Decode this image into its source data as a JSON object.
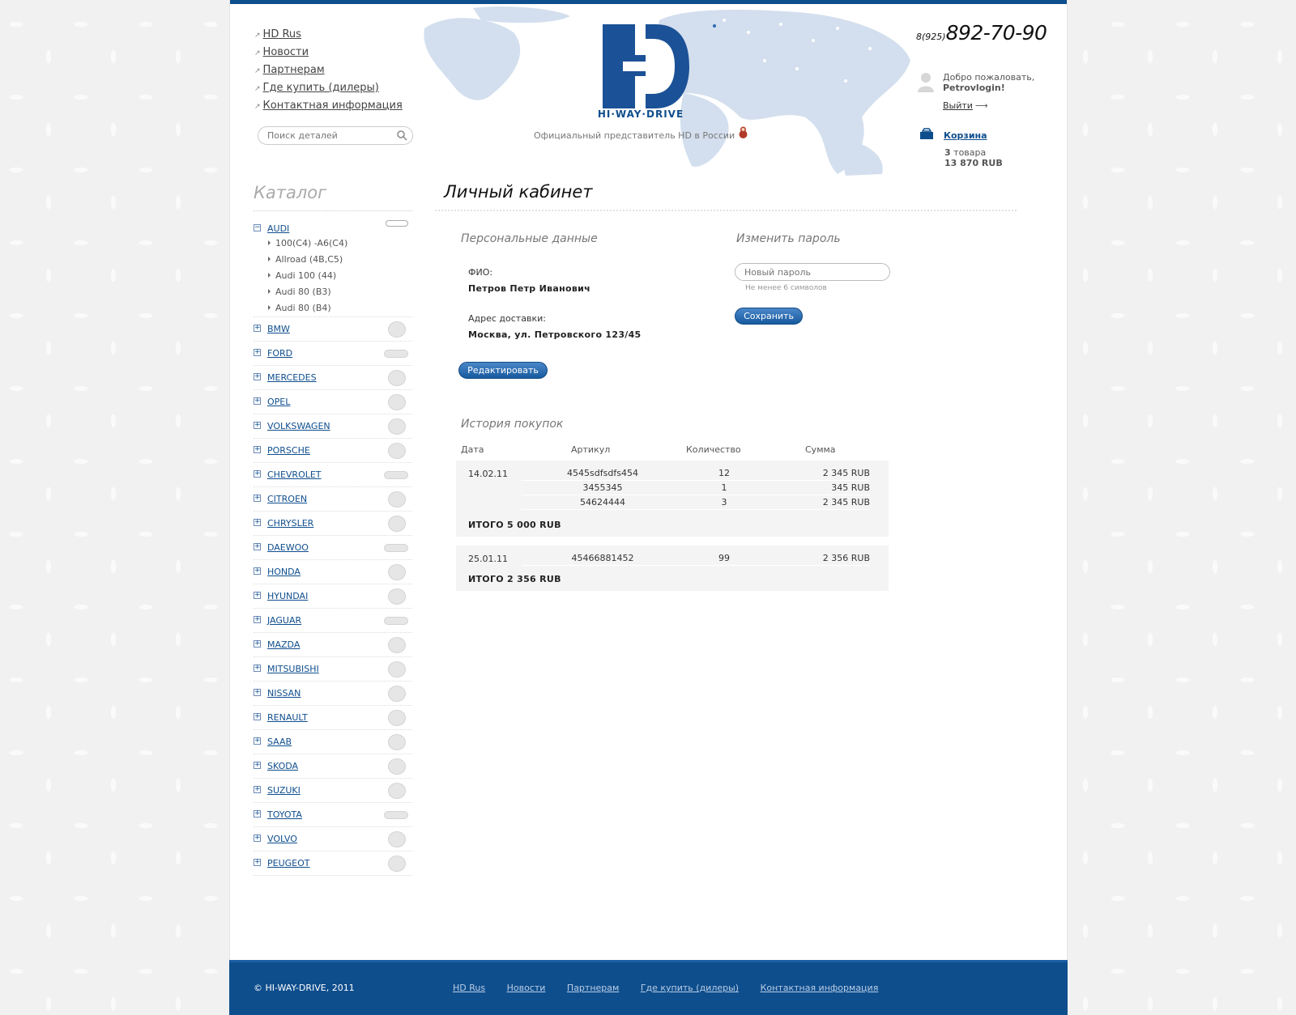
{
  "header": {
    "nav": [
      "HD Rus",
      "Новости",
      "Партнерам",
      "Где купить (дилеры)",
      "Контактная информация"
    ],
    "search_placeholder": "Поиск деталей",
    "logo_text": "HI·WAY·DRIVE",
    "tagline": "Официальный представитель HD в России",
    "phone_prefix": "8(925)",
    "phone_number": "892-70-90",
    "welcome": "Добро пожаловать,",
    "login": "Petrovlogin!",
    "logout": "Выйти",
    "cart_title": "Корзина",
    "cart_count": "3",
    "cart_count_label": "товара",
    "cart_sum": "13 870 RUB"
  },
  "catalog": {
    "title": "Каталог",
    "open_brand": "AUDI",
    "models": [
      "100(C4) -A6(C4)",
      "Allroad (4B,C5)",
      "Audi 100 (44)",
      "Audi 80 (B3)",
      "Audi 80 (B4)"
    ],
    "brands": [
      "BMW",
      "FORD",
      "MERCEDES",
      "OPEL",
      "VOLKSWAGEN",
      "PORSCHE",
      "CHEVROLET",
      "CITROEN",
      "CHRYSLER",
      "DAEWOO",
      "HONDA",
      "HYUNDAI",
      "JAGUAR",
      "MAZDA",
      "MITSUBISHI",
      "NISSAN",
      "RENAULT",
      "SAAB",
      "SKODA",
      "SUZUKI",
      "TOYOTA",
      "VOLVO",
      "PEUGEOT"
    ],
    "toggle_open": "−",
    "toggle_closed": "+"
  },
  "main": {
    "title": "Личный кабинет",
    "personal_title": "Персональные данные",
    "fio_label": "ФИО:",
    "fio_value": "Петров Петр Иванович",
    "address_label": "Адрес доставки:",
    "address_value": "Москва, ул. Петровского 123/45",
    "edit_button": "Редактировать",
    "password_title": "Изменить пароль",
    "password_placeholder": "Новый пароль",
    "password_hint": "Не менее 6 символов",
    "save_button": "Сохранить",
    "history_title": "История покупок",
    "columns": [
      "Дата",
      "Артикул",
      "Количество",
      "Сумма"
    ],
    "orders": [
      {
        "date": "14.02.11",
        "items": [
          {
            "article": "4545sdfsdfs454",
            "qty": "12",
            "sum": "2 345 RUB"
          },
          {
            "article": "3455345",
            "qty": "1",
            "sum": "345 RUB"
          },
          {
            "article": "54624444",
            "qty": "3",
            "sum": "2 345 RUB"
          }
        ],
        "total": "ИТОГО 5 000 RUB"
      },
      {
        "date": "25.01.11",
        "items": [
          {
            "article": "45466881452",
            "qty": "99",
            "sum": "2 356 RUB"
          }
        ],
        "total": "ИТОГО 2 356 RUB"
      }
    ]
  },
  "footer": {
    "copyright": "© HI-WAY-DRIVE, 2011",
    "nav": [
      "HD Rus",
      "Новости",
      "Партнерам",
      "Где купить (дилеры)",
      "Контактная информация"
    ]
  },
  "colors": {
    "brand_blue": "#0f4e8d",
    "button_blue": "#2a6db4",
    "map": "#d3dfee"
  }
}
